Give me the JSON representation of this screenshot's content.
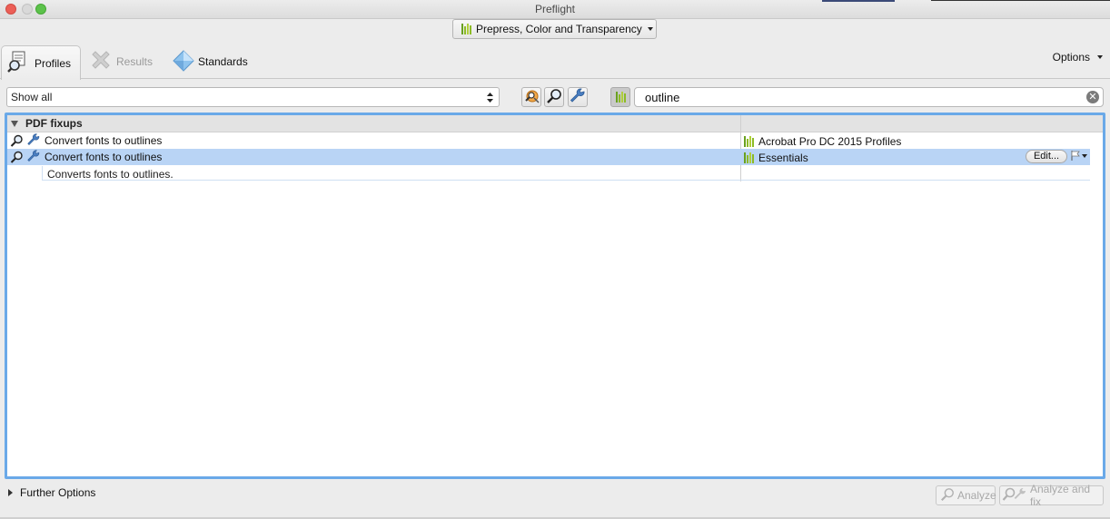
{
  "window": {
    "title": "Preflight"
  },
  "profile_popup": {
    "label": "Prepress, Color and Transparency"
  },
  "tabs": [
    {
      "label": "Profiles",
      "icon": "profiles-icon",
      "active": true
    },
    {
      "label": "Results",
      "icon": "results-icon",
      "active": false
    },
    {
      "label": "Standards",
      "icon": "standards-icon",
      "active": false
    }
  ],
  "options": {
    "label": "Options"
  },
  "filter": {
    "selected": "Show all"
  },
  "search": {
    "value": "outline"
  },
  "list": {
    "group_title": "PDF fixups",
    "rows": [
      {
        "name": "Convert fonts to outlines",
        "library": "Acrobat Pro DC 2015 Profiles",
        "selected": false
      },
      {
        "name": "Convert fonts to outlines",
        "library": "Essentials",
        "selected": true
      }
    ],
    "description": "Converts fonts to outlines.",
    "edit_label": "Edit..."
  },
  "bottom": {
    "further_options": "Further Options",
    "analyze": "Analyze",
    "analyze_fix": "Analyze and fix"
  },
  "colors": {
    "selection": "#b9d4f5",
    "focus_ring": "#6aa9e8",
    "bars_green": "#8dbb27"
  }
}
